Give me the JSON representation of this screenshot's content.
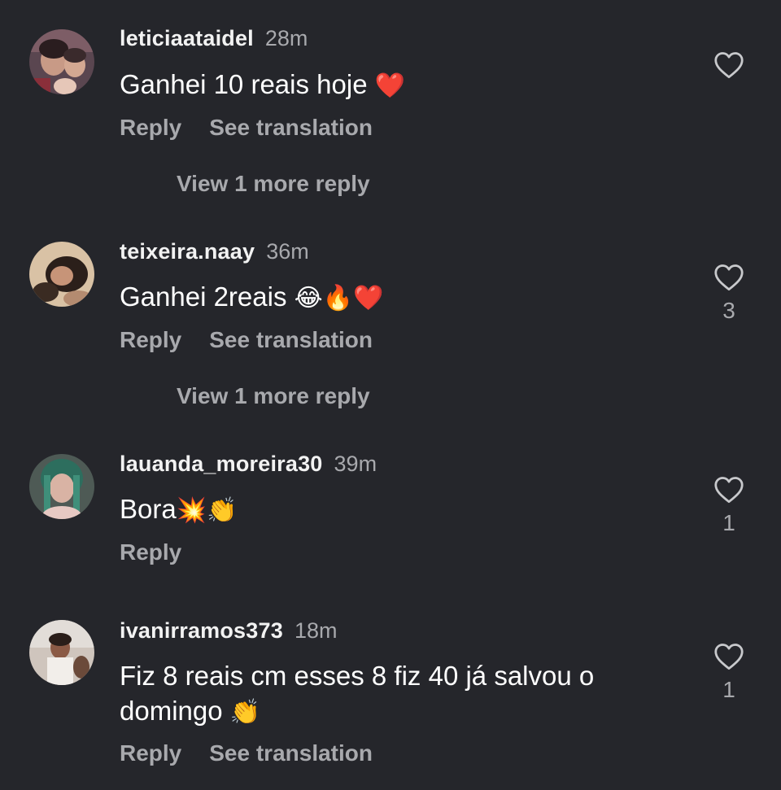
{
  "comments": [
    {
      "username": "leticiaataidel",
      "time": "28m",
      "text": "Ganhei 10 reais hoje",
      "emojis": "❤️",
      "actions": {
        "reply": "Reply",
        "translate": "See translation"
      },
      "view_more": "View 1 more reply",
      "likes": ""
    },
    {
      "username": "teixeira.naay",
      "time": "36m",
      "text": "Ganhei 2reais",
      "emojis": "😂🔥❤️",
      "actions": {
        "reply": "Reply",
        "translate": "See translation"
      },
      "view_more": "View 1 more reply",
      "likes": "3"
    },
    {
      "username": "lauanda_moreira30",
      "time": "39m",
      "text": "Bora",
      "emojis": "💥👏",
      "actions": {
        "reply": "Reply"
      },
      "likes": "1"
    },
    {
      "username": "ivanirramos373",
      "time": "18m",
      "text_line1": "Fiz 8 reais cm esses 8 fiz 40 já salvou o",
      "text_line2": "domingo",
      "emojis": "👏",
      "actions": {
        "reply": "Reply",
        "translate": "See translation"
      },
      "likes": "1"
    }
  ],
  "icons": {
    "avatar": "profile-photo",
    "like": "heart-outline-icon"
  },
  "colors": {
    "background": "#25262b",
    "secondary_text": "#a8a9ad",
    "primary_text": "#ffffff"
  }
}
